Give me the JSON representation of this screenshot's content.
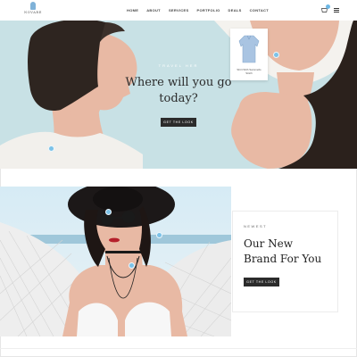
{
  "header": {
    "logo_text": "NOVARE",
    "nav": [
      "HOME",
      "ABOUT",
      "SERVICES",
      "PORTFOLIO",
      "DEALS",
      "CONTACT"
    ],
    "cart_icon": "shopping-bag-icon",
    "menu_icon": "hamburger-menu-icon"
  },
  "hero": {
    "eyebrow": "TRAVEL HER",
    "title": "Where will you go today?",
    "button": "GET THE LOOK",
    "product_name": "Shirt With Sammello Stitch",
    "background": "#c8e1e5"
  },
  "promo": {
    "eyebrow": "NEWEST",
    "title": "Our New Brand For You",
    "button": "GET THE LOOK"
  },
  "colors": {
    "accent": "#7cc2e8",
    "button_dark": "#2b2b2b",
    "text_dark": "#2a2a2a"
  }
}
